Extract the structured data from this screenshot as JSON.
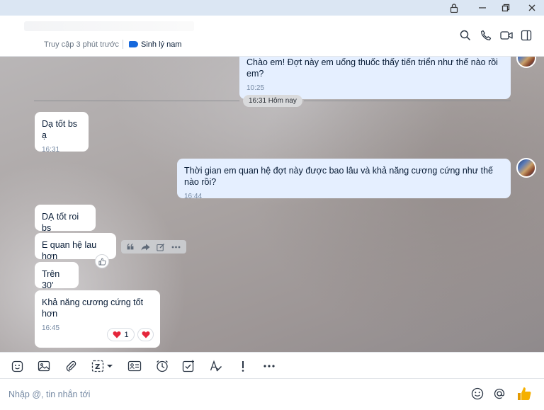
{
  "window": {
    "controls": {
      "lock": "lock-icon",
      "minimize": "minimize-icon",
      "restore": "restore-icon",
      "close": "close-icon"
    }
  },
  "header": {
    "status": "Truy cập 3 phút trước",
    "tag_label": "Sinh lý nam",
    "tag_color": "#1668dc",
    "icons": [
      "search-icon",
      "phone-icon",
      "video-icon",
      "sidebar-icon"
    ]
  },
  "chat": {
    "messages": [
      {
        "direction": "out",
        "text": "Chào em! Đợt này em uống thuốc thấy tiến triển như thế nào rồi em?",
        "time": "10:25"
      },
      {
        "direction": "in",
        "text": "Dạ tốt bs ạ",
        "time": "16:31"
      },
      {
        "direction": "out",
        "text": "Thời gian em quan hệ đợt này được bao lâu và khả năng cương cứng như thế nào rồi?",
        "time": "16:44"
      },
      {
        "direction": "in",
        "text": "DẠ tốt roi bs"
      },
      {
        "direction": "in",
        "text": "E quan hệ lau hơn"
      },
      {
        "direction": "in",
        "text": "Trên 30’"
      },
      {
        "direction": "in",
        "text": "Khả năng cương cứng tốt hơn",
        "time": "16:45",
        "reactions": {
          "heart_count": "1"
        }
      }
    ],
    "separator": "16:31 Hôm nay",
    "hover_actions": [
      "quote-icon",
      "forward-icon",
      "edit-icon",
      "more-icon"
    ]
  },
  "toolbar": {
    "icons": [
      "sticker-icon",
      "image-icon",
      "attach-icon",
      "screenshot-icon",
      "contact-card-icon",
      "reminder-icon",
      "todo-icon",
      "format-text-icon",
      "urgent-icon",
      "more-icon"
    ]
  },
  "composer": {
    "placeholder": "Nhập @, tin nhắn tới",
    "value": "",
    "icons": [
      "emoji-icon",
      "mention-icon",
      "thumbs-up-icon"
    ]
  },
  "colors": {
    "bubble_out": "#e5efff",
    "bubble_in": "#ffffff",
    "accent": "#1668dc",
    "heart": "#e5263b",
    "thumb": "#f5b000"
  }
}
